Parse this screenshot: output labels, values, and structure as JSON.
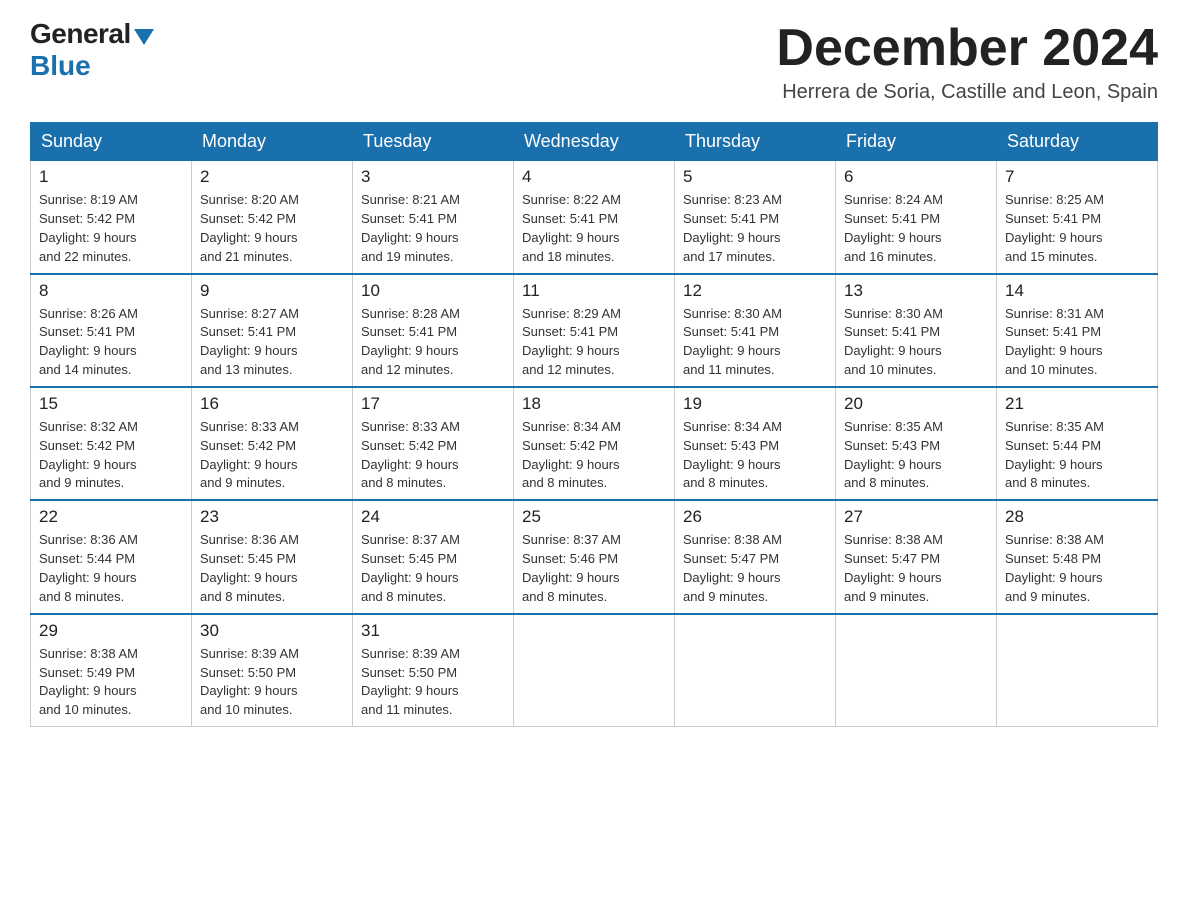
{
  "logo": {
    "general": "General",
    "blue": "Blue",
    "triangle": "▾"
  },
  "title": {
    "month": "December 2024",
    "location": "Herrera de Soria, Castille and Leon, Spain"
  },
  "weekdays": [
    "Sunday",
    "Monday",
    "Tuesday",
    "Wednesday",
    "Thursday",
    "Friday",
    "Saturday"
  ],
  "weeks": [
    [
      {
        "day": "1",
        "sunrise": "8:19 AM",
        "sunset": "5:42 PM",
        "daylight": "9 hours and 22 minutes."
      },
      {
        "day": "2",
        "sunrise": "8:20 AM",
        "sunset": "5:42 PM",
        "daylight": "9 hours and 21 minutes."
      },
      {
        "day": "3",
        "sunrise": "8:21 AM",
        "sunset": "5:41 PM",
        "daylight": "9 hours and 19 minutes."
      },
      {
        "day": "4",
        "sunrise": "8:22 AM",
        "sunset": "5:41 PM",
        "daylight": "9 hours and 18 minutes."
      },
      {
        "day": "5",
        "sunrise": "8:23 AM",
        "sunset": "5:41 PM",
        "daylight": "9 hours and 17 minutes."
      },
      {
        "day": "6",
        "sunrise": "8:24 AM",
        "sunset": "5:41 PM",
        "daylight": "9 hours and 16 minutes."
      },
      {
        "day": "7",
        "sunrise": "8:25 AM",
        "sunset": "5:41 PM",
        "daylight": "9 hours and 15 minutes."
      }
    ],
    [
      {
        "day": "8",
        "sunrise": "8:26 AM",
        "sunset": "5:41 PM",
        "daylight": "9 hours and 14 minutes."
      },
      {
        "day": "9",
        "sunrise": "8:27 AM",
        "sunset": "5:41 PM",
        "daylight": "9 hours and 13 minutes."
      },
      {
        "day": "10",
        "sunrise": "8:28 AM",
        "sunset": "5:41 PM",
        "daylight": "9 hours and 12 minutes."
      },
      {
        "day": "11",
        "sunrise": "8:29 AM",
        "sunset": "5:41 PM",
        "daylight": "9 hours and 12 minutes."
      },
      {
        "day": "12",
        "sunrise": "8:30 AM",
        "sunset": "5:41 PM",
        "daylight": "9 hours and 11 minutes."
      },
      {
        "day": "13",
        "sunrise": "8:30 AM",
        "sunset": "5:41 PM",
        "daylight": "9 hours and 10 minutes."
      },
      {
        "day": "14",
        "sunrise": "8:31 AM",
        "sunset": "5:41 PM",
        "daylight": "9 hours and 10 minutes."
      }
    ],
    [
      {
        "day": "15",
        "sunrise": "8:32 AM",
        "sunset": "5:42 PM",
        "daylight": "9 hours and 9 minutes."
      },
      {
        "day": "16",
        "sunrise": "8:33 AM",
        "sunset": "5:42 PM",
        "daylight": "9 hours and 9 minutes."
      },
      {
        "day": "17",
        "sunrise": "8:33 AM",
        "sunset": "5:42 PM",
        "daylight": "9 hours and 8 minutes."
      },
      {
        "day": "18",
        "sunrise": "8:34 AM",
        "sunset": "5:42 PM",
        "daylight": "9 hours and 8 minutes."
      },
      {
        "day": "19",
        "sunrise": "8:34 AM",
        "sunset": "5:43 PM",
        "daylight": "9 hours and 8 minutes."
      },
      {
        "day": "20",
        "sunrise": "8:35 AM",
        "sunset": "5:43 PM",
        "daylight": "9 hours and 8 minutes."
      },
      {
        "day": "21",
        "sunrise": "8:35 AM",
        "sunset": "5:44 PM",
        "daylight": "9 hours and 8 minutes."
      }
    ],
    [
      {
        "day": "22",
        "sunrise": "8:36 AM",
        "sunset": "5:44 PM",
        "daylight": "9 hours and 8 minutes."
      },
      {
        "day": "23",
        "sunrise": "8:36 AM",
        "sunset": "5:45 PM",
        "daylight": "9 hours and 8 minutes."
      },
      {
        "day": "24",
        "sunrise": "8:37 AM",
        "sunset": "5:45 PM",
        "daylight": "9 hours and 8 minutes."
      },
      {
        "day": "25",
        "sunrise": "8:37 AM",
        "sunset": "5:46 PM",
        "daylight": "9 hours and 8 minutes."
      },
      {
        "day": "26",
        "sunrise": "8:38 AM",
        "sunset": "5:47 PM",
        "daylight": "9 hours and 9 minutes."
      },
      {
        "day": "27",
        "sunrise": "8:38 AM",
        "sunset": "5:47 PM",
        "daylight": "9 hours and 9 minutes."
      },
      {
        "day": "28",
        "sunrise": "8:38 AM",
        "sunset": "5:48 PM",
        "daylight": "9 hours and 9 minutes."
      }
    ],
    [
      {
        "day": "29",
        "sunrise": "8:38 AM",
        "sunset": "5:49 PM",
        "daylight": "9 hours and 10 minutes."
      },
      {
        "day": "30",
        "sunrise": "8:39 AM",
        "sunset": "5:50 PM",
        "daylight": "9 hours and 10 minutes."
      },
      {
        "day": "31",
        "sunrise": "8:39 AM",
        "sunset": "5:50 PM",
        "daylight": "9 hours and 11 minutes."
      },
      null,
      null,
      null,
      null
    ]
  ],
  "labels": {
    "sunrise": "Sunrise:",
    "sunset": "Sunset:",
    "daylight": "Daylight:"
  }
}
